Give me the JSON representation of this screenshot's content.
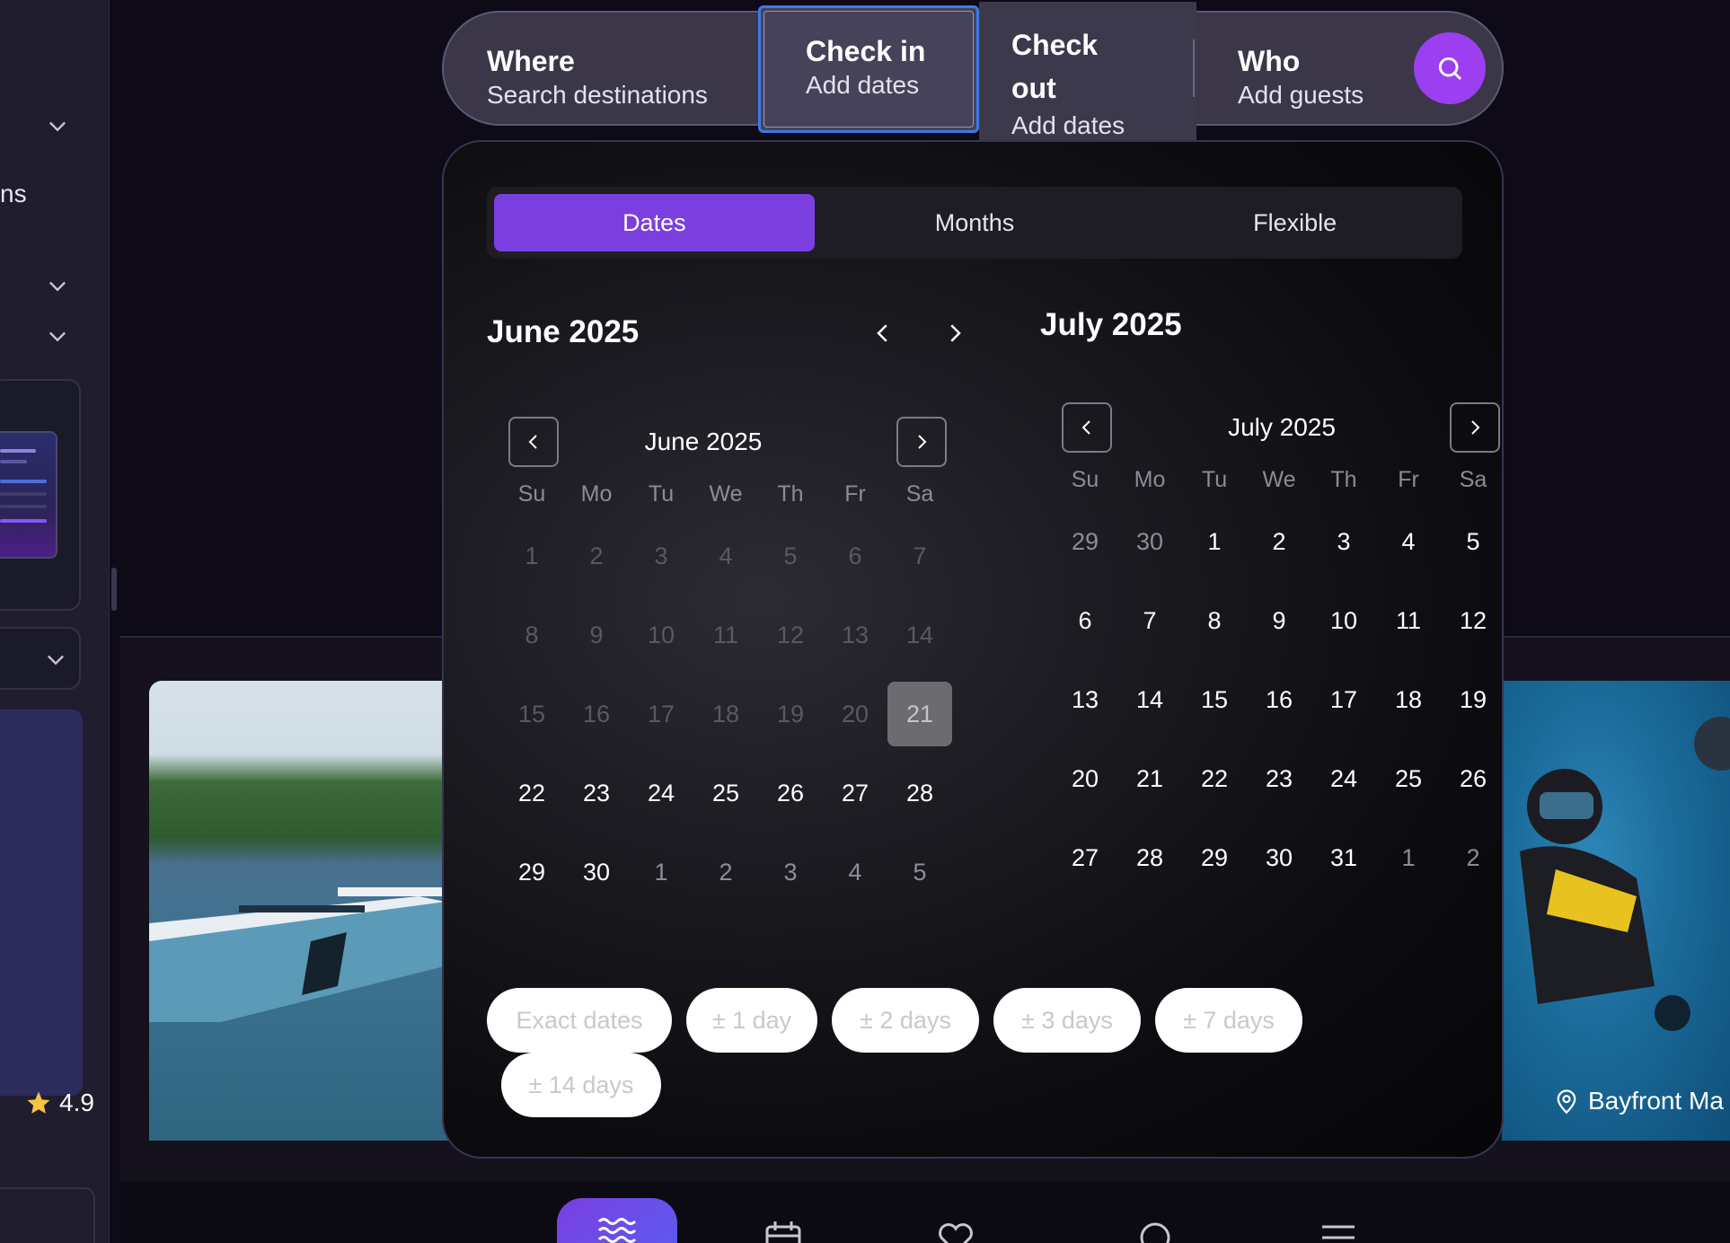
{
  "sidebar": {
    "partial_text": "ns"
  },
  "search_bar": {
    "where": {
      "title": "Where",
      "sub": "Search destinations"
    },
    "check_in": {
      "title": "Check in",
      "sub": "Add dates"
    },
    "check_out": {
      "title_line1": "Check",
      "title_line2": "out",
      "sub": "Add dates"
    },
    "who": {
      "title": "Who",
      "sub": "Add guests"
    },
    "search_icon": "search-icon"
  },
  "picker": {
    "tabs": [
      {
        "label": "Dates",
        "active": true
      },
      {
        "label": "Months",
        "active": false
      },
      {
        "label": "Flexible",
        "active": false
      }
    ],
    "header_left": "June 2025",
    "header_right": "July 2025",
    "weekdays": [
      "Su",
      "Mo",
      "Tu",
      "We",
      "Th",
      "Fr",
      "Sa"
    ],
    "june": {
      "title": "June 2025",
      "weeks": [
        [
          {
            "d": "1",
            "s": "muted"
          },
          {
            "d": "2",
            "s": "muted"
          },
          {
            "d": "3",
            "s": "muted"
          },
          {
            "d": "4",
            "s": "muted"
          },
          {
            "d": "5",
            "s": "muted"
          },
          {
            "d": "6",
            "s": "muted"
          },
          {
            "d": "7",
            "s": "muted"
          }
        ],
        [
          {
            "d": "8",
            "s": "muted"
          },
          {
            "d": "9",
            "s": "muted"
          },
          {
            "d": "10",
            "s": "muted"
          },
          {
            "d": "11",
            "s": "muted"
          },
          {
            "d": "12",
            "s": "muted"
          },
          {
            "d": "13",
            "s": "muted"
          },
          {
            "d": "14",
            "s": "muted"
          }
        ],
        [
          {
            "d": "15",
            "s": "muted"
          },
          {
            "d": "16",
            "s": "muted"
          },
          {
            "d": "17",
            "s": "muted"
          },
          {
            "d": "18",
            "s": "muted"
          },
          {
            "d": "19",
            "s": "muted"
          },
          {
            "d": "20",
            "s": "muted"
          },
          {
            "d": "21",
            "s": "sel"
          }
        ],
        [
          {
            "d": "22",
            "s": ""
          },
          {
            "d": "23",
            "s": ""
          },
          {
            "d": "24",
            "s": ""
          },
          {
            "d": "25",
            "s": ""
          },
          {
            "d": "26",
            "s": ""
          },
          {
            "d": "27",
            "s": ""
          },
          {
            "d": "28",
            "s": ""
          }
        ],
        [
          {
            "d": "29",
            "s": ""
          },
          {
            "d": "30",
            "s": ""
          },
          {
            "d": "1",
            "s": "other"
          },
          {
            "d": "2",
            "s": "other"
          },
          {
            "d": "3",
            "s": "other"
          },
          {
            "d": "4",
            "s": "other"
          },
          {
            "d": "5",
            "s": "other"
          }
        ]
      ]
    },
    "july": {
      "title": "July 2025",
      "weeks": [
        [
          {
            "d": "29",
            "s": "other"
          },
          {
            "d": "30",
            "s": "other"
          },
          {
            "d": "1",
            "s": ""
          },
          {
            "d": "2",
            "s": ""
          },
          {
            "d": "3",
            "s": ""
          },
          {
            "d": "4",
            "s": ""
          },
          {
            "d": "5",
            "s": ""
          }
        ],
        [
          {
            "d": "6",
            "s": ""
          },
          {
            "d": "7",
            "s": ""
          },
          {
            "d": "8",
            "s": ""
          },
          {
            "d": "9",
            "s": ""
          },
          {
            "d": "10",
            "s": ""
          },
          {
            "d": "11",
            "s": ""
          },
          {
            "d": "12",
            "s": ""
          }
        ],
        [
          {
            "d": "13",
            "s": ""
          },
          {
            "d": "14",
            "s": ""
          },
          {
            "d": "15",
            "s": ""
          },
          {
            "d": "16",
            "s": ""
          },
          {
            "d": "17",
            "s": ""
          },
          {
            "d": "18",
            "s": ""
          },
          {
            "d": "19",
            "s": ""
          }
        ],
        [
          {
            "d": "20",
            "s": ""
          },
          {
            "d": "21",
            "s": ""
          },
          {
            "d": "22",
            "s": ""
          },
          {
            "d": "23",
            "s": ""
          },
          {
            "d": "24",
            "s": ""
          },
          {
            "d": "25",
            "s": ""
          },
          {
            "d": "26",
            "s": ""
          }
        ],
        [
          {
            "d": "27",
            "s": ""
          },
          {
            "d": "28",
            "s": ""
          },
          {
            "d": "29",
            "s": ""
          },
          {
            "d": "30",
            "s": ""
          },
          {
            "d": "31",
            "s": ""
          },
          {
            "d": "1",
            "s": "other"
          },
          {
            "d": "2",
            "s": "other"
          }
        ]
      ]
    },
    "flex_chips": [
      "Exact dates",
      "± 1 day",
      "± 2 days",
      "± 3 days",
      "± 7 days",
      "± 14 days"
    ]
  },
  "listing_left": {
    "rating": "4.9"
  },
  "listing_right": {
    "location": "Bayfront Ma"
  },
  "bottom_nav": {
    "items": [
      "waves-icon",
      "calendar-icon",
      "heart-icon",
      "search-icon",
      "menu-icon"
    ],
    "active": "waves-icon"
  },
  "colors": {
    "accent": "#7b3fe0",
    "search_button": "#9b3ff0",
    "focus_ring": "#3b7ae8"
  }
}
